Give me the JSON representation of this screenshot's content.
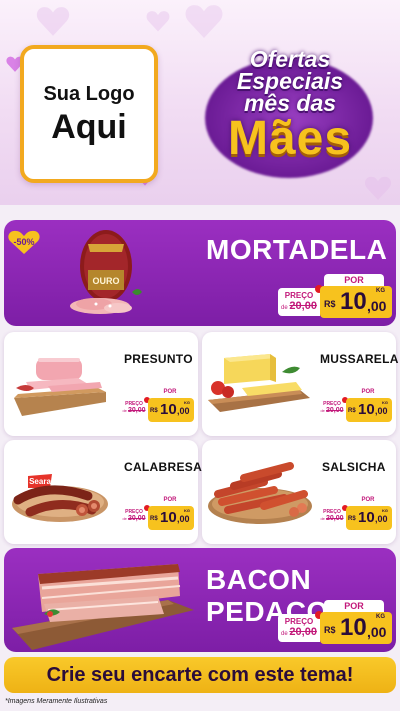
{
  "logo": {
    "line1": "Sua Logo",
    "line2": "Aqui"
  },
  "title": {
    "line1": "Ofertas",
    "line2": "Especiais",
    "line3": "mês das",
    "line4": "Mães"
  },
  "colors": {
    "purple": "#8a24b3",
    "yellow": "#f7c21e",
    "pink": "#c2187a",
    "bg": "#f4eef6"
  },
  "badge": {
    "label": "-50%"
  },
  "products": [
    {
      "name": "MORTADELA",
      "brand": "OURO",
      "por": "POR",
      "preco": "PREÇO",
      "de": "de",
      "old_price": "20,00",
      "currency": "R$",
      "new_integer": "10",
      "new_decimal": ",00",
      "unit": "KG"
    },
    {
      "name": "PRESUNTO",
      "por": "POR",
      "preco": "PREÇO",
      "de": "de",
      "old_price": "20,00",
      "currency": "R$",
      "new_integer": "10",
      "new_decimal": ",00",
      "unit": "KG"
    },
    {
      "name": "MUSSARELA",
      "por": "POR",
      "preco": "PREÇO",
      "de": "de",
      "old_price": "20,00",
      "currency": "R$",
      "new_integer": "10",
      "new_decimal": ",00",
      "unit": "KG"
    },
    {
      "name": "CALABRESA",
      "brand": "Seara",
      "por": "POR",
      "preco": "PREÇO",
      "de": "de",
      "old_price": "20,00",
      "currency": "R$",
      "new_integer": "10",
      "new_decimal": ",00",
      "unit": "KG"
    },
    {
      "name": "SALSICHA",
      "por": "POR",
      "preco": "PREÇO",
      "de": "de",
      "old_price": "20,00",
      "currency": "R$",
      "new_integer": "10",
      "new_decimal": ",00",
      "unit": "KG"
    },
    {
      "name": "BACON PEDAÇO",
      "por": "POR",
      "preco": "PREÇO",
      "de": "de",
      "old_price": "20,00",
      "currency": "R$",
      "new_integer": "10",
      "new_decimal": ",00",
      "unit": "KG"
    }
  ],
  "cta": {
    "label": "Crie seu encarte com este tema!"
  },
  "footnote": "*Imagens Meramente Ilustrativas"
}
